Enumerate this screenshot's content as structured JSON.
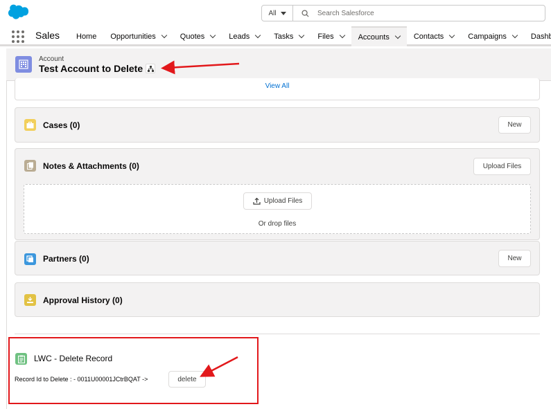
{
  "colors": {
    "brand_blue": "#00a1e0",
    "link_blue": "#0070d2",
    "annotation_red": "#e2181b",
    "account_icon": "#7f8de1"
  },
  "global_header": {
    "logo_icon": "salesforce-cloud-icon",
    "search_scope": "All",
    "search_placeholder": "Search Salesforce"
  },
  "nav": {
    "app_name": "Sales",
    "items": [
      {
        "label": "Home",
        "has_menu": false,
        "active": false
      },
      {
        "label": "Opportunities",
        "has_menu": true,
        "active": false
      },
      {
        "label": "Quotes",
        "has_menu": true,
        "active": false
      },
      {
        "label": "Leads",
        "has_menu": true,
        "active": false
      },
      {
        "label": "Tasks",
        "has_menu": true,
        "active": false
      },
      {
        "label": "Files",
        "has_menu": true,
        "active": false
      },
      {
        "label": "Accounts",
        "has_menu": true,
        "active": true
      },
      {
        "label": "Contacts",
        "has_menu": true,
        "active": false
      },
      {
        "label": "Campaigns",
        "has_menu": true,
        "active": false
      },
      {
        "label": "Dashb",
        "has_menu": false,
        "active": false
      }
    ]
  },
  "record_header": {
    "entity_label": "Account",
    "title": "Test Account to Delete"
  },
  "related": {
    "view_all": "View All",
    "cases": {
      "title": "Cases (0)",
      "button": "New"
    },
    "notes": {
      "title": "Notes & Attachments (0)",
      "button": "Upload Files",
      "drop_button": "Upload Files",
      "drop_text": "Or drop files"
    },
    "partners": {
      "title": "Partners (0)",
      "button": "New"
    },
    "approval": {
      "title": "Approval History (0)"
    }
  },
  "lwc": {
    "title": "LWC - Delete Record",
    "record_id_text": "Record Id to Delete : - 0011U00001JCtrBQAT ->",
    "delete_button": "delete"
  }
}
